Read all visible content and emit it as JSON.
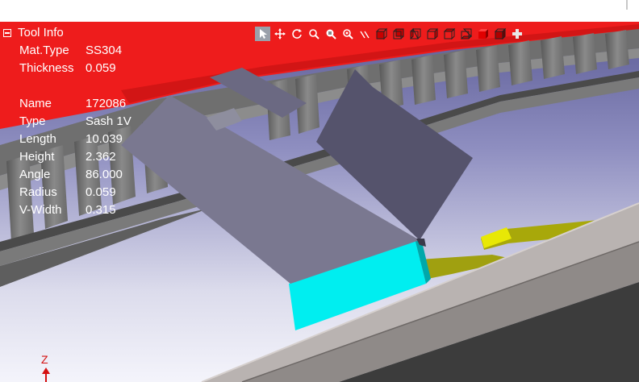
{
  "tool_info": {
    "title": "Tool Info",
    "material_rows": [
      {
        "label": "Mat.Type",
        "value": "SS304"
      },
      {
        "label": "Thickness",
        "value": "0.059"
      }
    ],
    "tool_rows": [
      {
        "label": "Name",
        "value": "172086"
      },
      {
        "label": "Type",
        "value": "Sash 1V"
      },
      {
        "label": "Length",
        "value": "10.039"
      },
      {
        "label": "Height",
        "value": "2.362"
      },
      {
        "label": "Angle",
        "value": "86.000"
      },
      {
        "label": "Radius",
        "value": "0.059"
      },
      {
        "label": "V-Width",
        "value": "0.315"
      }
    ]
  },
  "toolbar": {
    "icons": [
      "select-arrow-icon",
      "pan-icon",
      "rotate-icon",
      "zoom-icon",
      "zoom-window-icon",
      "zoom-fit-icon",
      "measure-icon",
      "view-front-icon",
      "view-back-icon",
      "view-left-icon",
      "view-right-icon",
      "view-top-icon",
      "view-bottom-icon",
      "view-iso-red-icon",
      "view-iso-solid-icon",
      "plus-icon"
    ]
  },
  "axis": {
    "z_label": "Z"
  },
  "colors": {
    "punch_band": "#ee1c1c",
    "background_top": "#6a6aa2",
    "background_bottom": "#f2f2fa",
    "tool_gray": "#7d7d7d",
    "sheet_face": "#787690",
    "sheet_side": "#5b5972",
    "die_cyan": "#00eef0",
    "part_yellow": "#e8e806",
    "die_rail": "#b4aeac",
    "die_dark": "#3c3c3c"
  }
}
